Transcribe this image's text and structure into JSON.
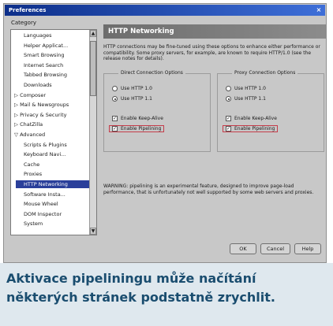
{
  "window": {
    "title": "Preferences",
    "close_glyph": "×"
  },
  "sidebar": {
    "label": "Category",
    "items": [
      {
        "label": "Languages"
      },
      {
        "label": "Helper Applicat..."
      },
      {
        "label": "Smart Browsing"
      },
      {
        "label": "Internet Search"
      },
      {
        "label": "Tabbed Browsing"
      },
      {
        "label": "Downloads"
      },
      {
        "label": "▷ Composer"
      },
      {
        "label": "▷ Mail & Newsgroups"
      },
      {
        "label": "▷ Privacy & Security"
      },
      {
        "label": "▷ ChatZilla"
      },
      {
        "label": "▽ Advanced"
      },
      {
        "label": "Scripts & Plugins"
      },
      {
        "label": "Keyboard Navi..."
      },
      {
        "label": "Cache"
      },
      {
        "label": "Proxies"
      },
      {
        "label": "HTTP Networking"
      },
      {
        "label": "Software Insta..."
      },
      {
        "label": "Mouse Wheel"
      },
      {
        "label": "DOM Inspector"
      },
      {
        "label": "System"
      }
    ],
    "selected_index": 15
  },
  "panel": {
    "title": "HTTP Networking",
    "description": "HTTP connections may be fine-tuned using these options to enhance either performance or compatibility. Some proxy servers, for example, are known to require HTTP/1.0 (see the release notes for details).",
    "direct": {
      "label": "Direct Connection Options",
      "radio1": "Use HTTP 1.0",
      "radio2": "Use HTTP 1.1",
      "check1": "Enable Keep-Alive",
      "check2": "Enable Pipelining"
    },
    "proxy": {
      "label": "Proxy Connection Options",
      "radio1": "Use HTTP 1.0",
      "radio2": "Use HTTP 1.1",
      "check1": "Enable Keep-Alive",
      "check2": "Enable Pipelining"
    },
    "warning": "WARNING: pipelining is an experimental feature, designed to improve page-load performance, that is unfortunately not well supported by some web servers and proxies."
  },
  "buttons": {
    "ok": "OK",
    "cancel": "Cancel",
    "help": "Help"
  },
  "caption": "Aktivace pipeliningu může načítání některých stránek podstatně zrychlit.",
  "colors": {
    "accent": "#2a3f9a",
    "caption_text": "#1a4d6f",
    "caption_bg": "#dfe8ee",
    "highlight": "#c43c4a"
  }
}
